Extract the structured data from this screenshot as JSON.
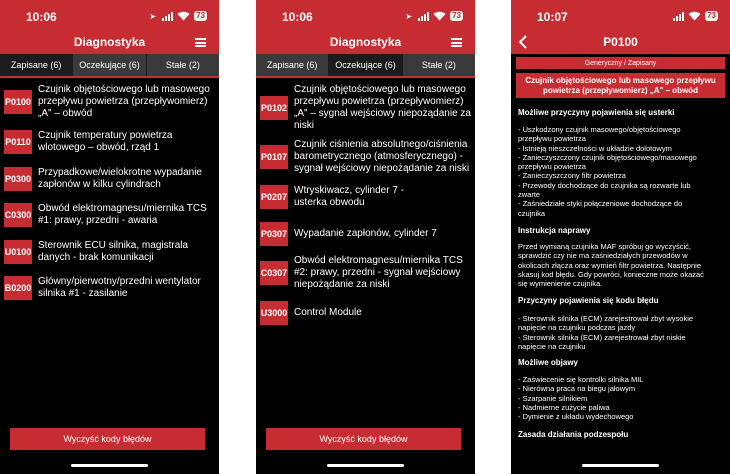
{
  "status": {
    "time_left": "10:06",
    "time_right": "10:07",
    "battery": "73"
  },
  "list_header": {
    "title": "Diagnostyka"
  },
  "tabs": [
    "Zapisane (6)",
    "Oczekujące (6)",
    "Stałe (2)"
  ],
  "saved_codes": [
    {
      "code": "P0100",
      "desc": [
        "Czujnik objętościowego lub masowego",
        "przepływu powietrza (przepływomierz)",
        "„A\" – obwód"
      ]
    },
    {
      "code": "P0110",
      "desc": [
        "Czujnik temperatury powietrza",
        "wlotowego – obwód, rząd 1"
      ]
    },
    {
      "code": "P0300",
      "desc": [
        "Przypadkowe/wielokrotne wypadanie",
        "zapłonów w kilku cylindrach"
      ]
    },
    {
      "code": "C0300",
      "desc": [
        "Obwód elektromagnesu/miernika TCS",
        "#1: prawy, przedni - awaria"
      ]
    },
    {
      "code": "U0100",
      "desc": [
        "Sterownik ECU silnika, magistrala",
        "danych - brak komunikacji"
      ]
    },
    {
      "code": "B0200",
      "desc": [
        "Główny/pierwotny/przedni wentylator",
        "silnika #1 - zasilanie"
      ]
    }
  ],
  "pending_codes": [
    {
      "code": "P0102",
      "desc": [
        "Czujnik objętościowego lub masowego",
        "przepływu powietrza (przepływomierz)",
        "„A\" – sygnał wejściowy niepożądanie za",
        "niski"
      ]
    },
    {
      "code": "P0107",
      "desc": [
        "Czujnik ciśnienia absolutnego/ciśnienia",
        "barometrycznego (atmosferycznego) -",
        "sygnał wejściowy niepożądanie za niski"
      ]
    },
    {
      "code": "P0207",
      "desc": [
        "Wtryskiwacz, cylinder 7 -",
        "usterka obwodu"
      ]
    },
    {
      "code": "P0307",
      "desc": [
        "Wypadanie zapłonów, cylinder 7"
      ]
    },
    {
      "code": "C0307",
      "desc": [
        "Obwód elektromagnesu/miernika TCS",
        "#2: prawy, przedni - sygnał wejściowy",
        "niepożądanie za niski"
      ]
    },
    {
      "code": "U3000",
      "desc": [
        "Control Module"
      ]
    }
  ],
  "clear_button": "Wyczyść kody błędów",
  "detail": {
    "title": "P0100",
    "chip": "Generyczny / Zapisany",
    "code_title": [
      "Czujnik objętościowego lub masowego przepływu",
      "powietrza (przepływomierz) „A\" – obwód"
    ],
    "sections": [
      {
        "heading": "Możliwe przyczyny pojawienia się usterki",
        "lines": [
          "- Uszkodzony czujnik masowego/objętościowego",
          "  przepływu powietrza",
          "- Istnieją nieszczelności w układzie dolotowym",
          "- Zanieczyszczony czujnik objętościowego/masowego",
          "  przepływu powietrza",
          "- Zanieczyszczony filtr powietrza",
          "- Przewody dochodzące do czujnika są rozwarte lub",
          "  zwarte",
          "- Zaśniedziałe styki połączeniowe dochodzące do",
          "  czujnika"
        ]
      },
      {
        "heading": "Instrukcja naprawy",
        "lines": [
          "Przed wymianą czujnika MAF spróbuj go wyczyścić,",
          "sprawdzić czy nie ma zaśniedziałych przewodów w",
          "okolicach złącza oraz wymień filtr powietrza. Następnie",
          "skasuj kod błędu. Gdy powróci, konieczne może okazać",
          "się wymienienie czujnika."
        ]
      },
      {
        "heading": "Przyczyny pojawienia się kodu błędu",
        "lines": [
          "- Sterownik silnika (ECM) zarejestrował zbyt wysokie",
          "napięcie na czujniku podczas jazdy",
          "- Sterownik silnika (ECM) zarejestrował zbyt niskie",
          "napięcie na czujniku"
        ]
      },
      {
        "heading": "Możliwe objawy",
        "lines": [
          "- Zaświecenie się kontrolki silnika MIL",
          "- Nierówna praca na biegu jałowym",
          "- Szarpanie silnikiem",
          "- Nadmierne zużycie paliwa",
          "- Dymienie z układu wydechowego"
        ]
      },
      {
        "heading": "Zasada działania podzespołu",
        "lines": []
      }
    ]
  }
}
